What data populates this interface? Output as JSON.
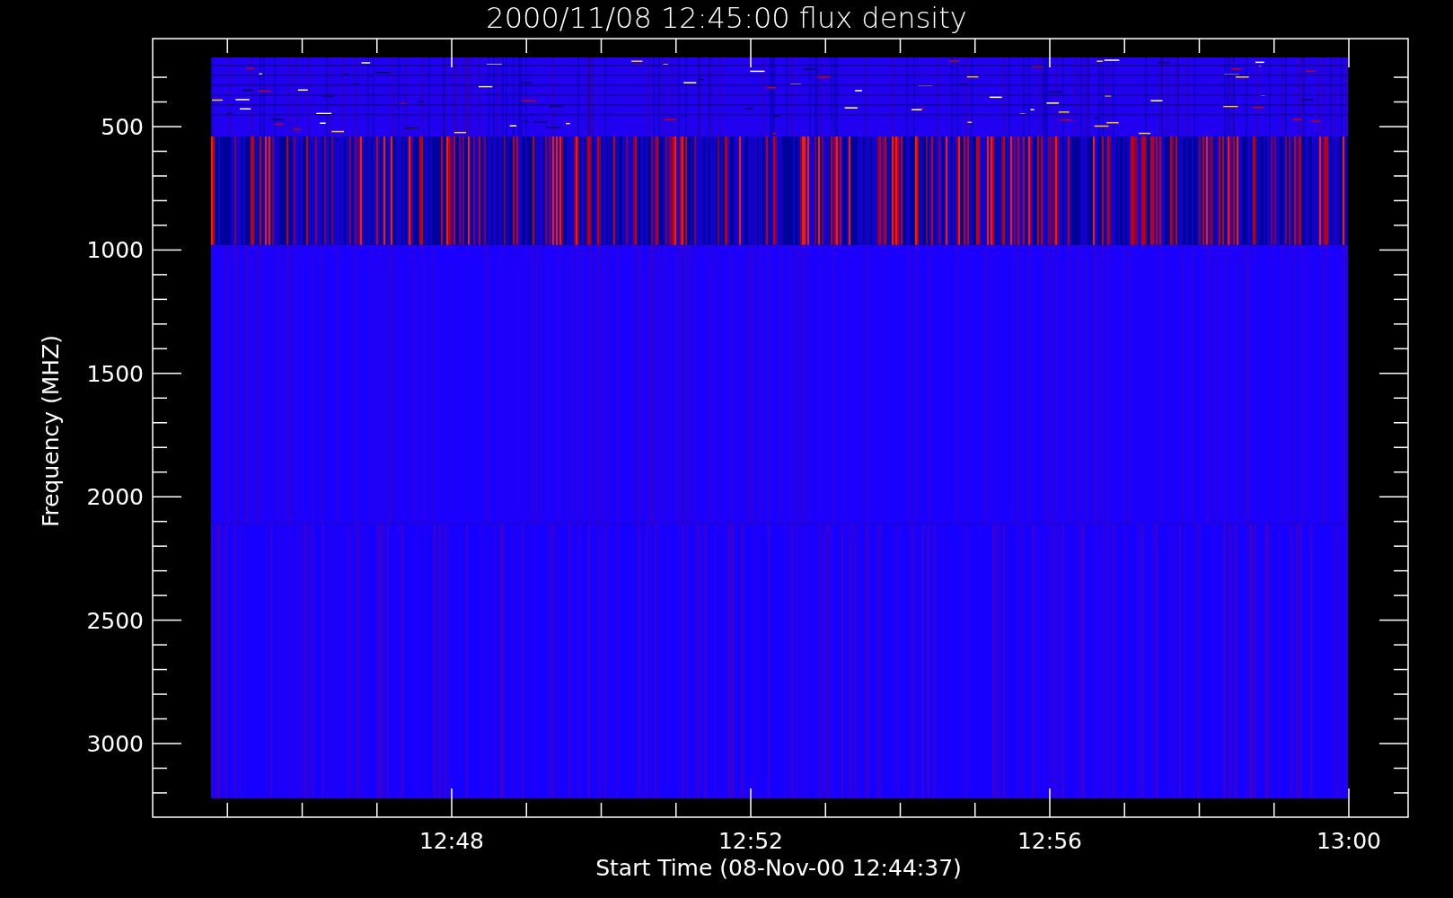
{
  "title": "2000/11/08 12:45:00 flux density",
  "y_axis": {
    "label": "Frequency (MHZ)",
    "ticks": [
      "500",
      "1000",
      "1500",
      "2000",
      "2500",
      "3000"
    ]
  },
  "x_axis": {
    "label": "Start Time (08-Nov-00 12:44:37)",
    "ticks": [
      "12:48",
      "12:52",
      "12:56",
      "13:00"
    ]
  }
}
